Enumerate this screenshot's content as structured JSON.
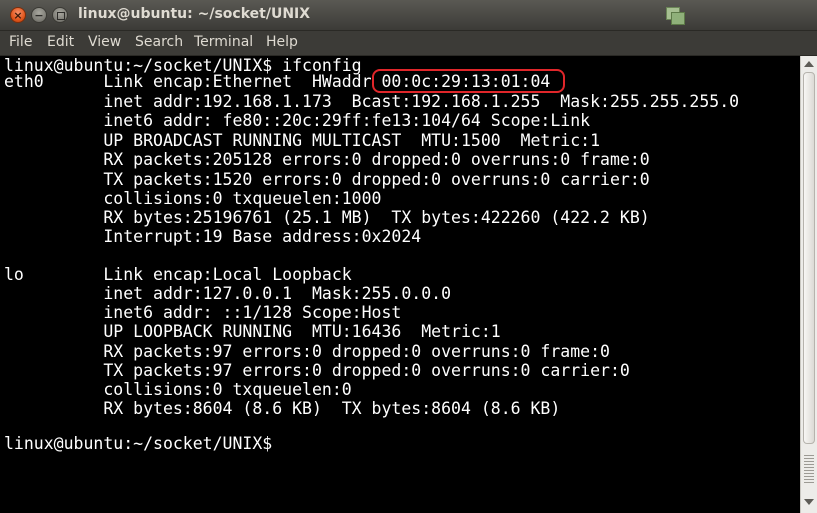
{
  "window": {
    "title": "linux@ubuntu: ~/socket/UNIX",
    "buttons": {
      "close_glyph": "×",
      "minimize_glyph": "−"
    }
  },
  "menu": {
    "items": [
      "File",
      "Edit",
      "View",
      "Search",
      "Terminal",
      "Help"
    ]
  },
  "terminal": {
    "lines": [
      "linux@ubuntu:~/socket/UNIX$ ifconfig",
      "eth0      Link encap:Ethernet  HWaddr 00:0c:29:13:01:04",
      "          inet addr:192.168.1.173  Bcast:192.168.1.255  Mask:255.255.255.0",
      "          inet6 addr: fe80::20c:29ff:fe13:104/64 Scope:Link",
      "          UP BROADCAST RUNNING MULTICAST  MTU:1500  Metric:1",
      "          RX packets:205128 errors:0 dropped:0 overruns:0 frame:0",
      "          TX packets:1520 errors:0 dropped:0 overruns:0 carrier:0",
      "          collisions:0 txqueuelen:1000",
      "          RX bytes:25196761 (25.1 MB)  TX bytes:422260 (422.2 KB)",
      "          Interrupt:19 Base address:0x2024",
      "",
      "lo        Link encap:Local Loopback",
      "          inet addr:127.0.0.1  Mask:255.0.0.0",
      "          inet6 addr: ::1/128 Scope:Host",
      "          UP LOOPBACK RUNNING  MTU:16436  Metric:1",
      "          RX packets:97 errors:0 dropped:0 overruns:0 frame:0",
      "          TX packets:97 errors:0 dropped:0 overruns:0 carrier:0",
      "          collisions:0 txqueuelen:0",
      "          RX bytes:8604 (8.6 KB)  TX bytes:8604 (8.6 KB)",
      "",
      "linux@ubuntu:~/socket/UNIX$"
    ],
    "highlighted_value": "00:0c:29:13:01:04",
    "highlight_color": "#e0262a",
    "foreground_color": "#ffffff",
    "background_color": "#000000"
  }
}
